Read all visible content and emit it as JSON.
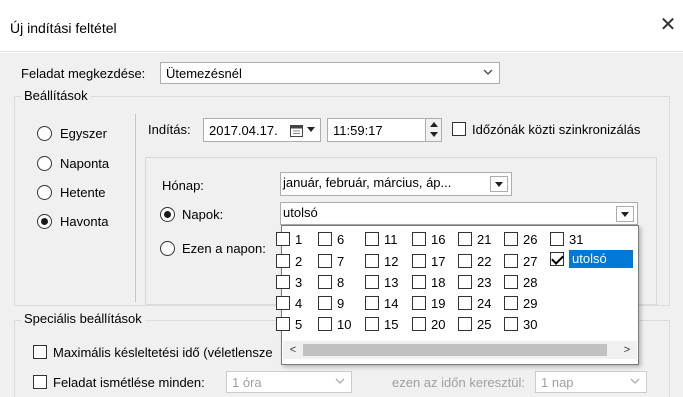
{
  "window": {
    "title": "Új indítási feltétel",
    "close_symbol": "✕"
  },
  "task_start": {
    "label": "Feladat megkezdése:",
    "value": "Ütemezésnél"
  },
  "settings": {
    "group_label": "Beállítások",
    "radios": [
      {
        "label": "Egyszer",
        "checked": false
      },
      {
        "label": "Naponta",
        "checked": false
      },
      {
        "label": "Hetente",
        "checked": false
      },
      {
        "label": "Havonta",
        "checked": true
      }
    ],
    "start_label": "Indítás:",
    "date_value": "2017.04.17.",
    "time_value": "11:59:17",
    "sync_label": "Időzónák közti szinkronizálás"
  },
  "monthly": {
    "month_label": "Hónap:",
    "month_value": "január, február, március, áp...",
    "days_label": "Napok:",
    "days_value": "utolsó",
    "on_days_label": "Ezen a napon:"
  },
  "day_list": {
    "columns": [
      [
        "1",
        "2",
        "3",
        "4",
        "5"
      ],
      [
        "6",
        "7",
        "8",
        "9",
        "10"
      ],
      [
        "11",
        "12",
        "13",
        "14",
        "15"
      ],
      [
        "16",
        "17",
        "18",
        "19",
        "20"
      ],
      [
        "21",
        "22",
        "23",
        "24",
        "25"
      ],
      [
        "26",
        "27",
        "28",
        "29",
        "30"
      ],
      [
        "31",
        "utolsó"
      ]
    ],
    "checked": [
      "utolsó"
    ]
  },
  "special": {
    "group_label": "Speciális beállítások",
    "max_delay_label": "Maximális késleltetési idő (véletlensze",
    "repeat_label": "Feladat ismétlése minden:",
    "repeat_value": "1 óra",
    "duration_label": "ezen az időn keresztül:",
    "duration_value": "1 nap"
  },
  "scroll": {
    "left_arrow": "<",
    "right_arrow": ">"
  },
  "icons": {
    "chevron": "chevron-down-icon",
    "calendar": "calendar-icon",
    "spin": "spin-updown-icon"
  }
}
